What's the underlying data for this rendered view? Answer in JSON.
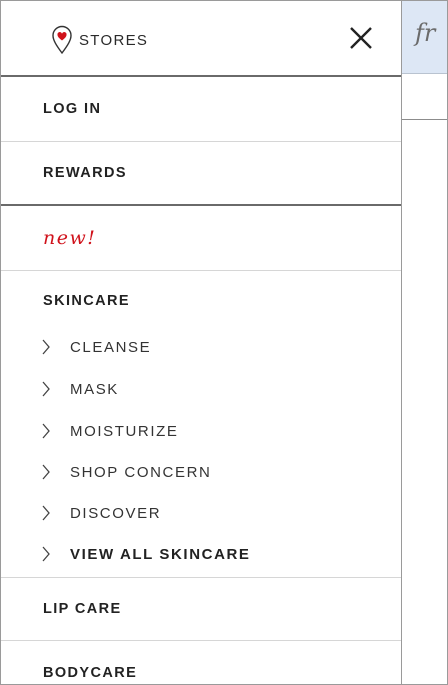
{
  "drawer": {
    "stores_label": "STORES",
    "menu": {
      "log_in": "LOG IN",
      "rewards": "REWARDS",
      "new": "new!",
      "skincare": {
        "heading": "SKINCARE",
        "items": [
          "CLEANSE",
          "MASK",
          "MOISTURIZE",
          "SHOP CONCERN",
          "DISCOVER",
          "VIEW ALL SKINCARE"
        ]
      },
      "lip_care": "LIP CARE",
      "bodycare": "BODYCARE"
    }
  },
  "background_page": {
    "logo_text": "fr"
  },
  "colors": {
    "accent_red": "#d0121b",
    "header_bg": "#dde7f5"
  }
}
